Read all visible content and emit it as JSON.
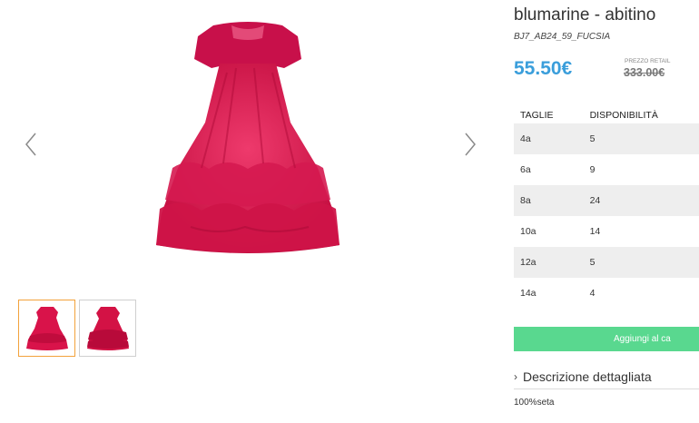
{
  "gallery": {
    "prev_icon": "chevron-left-icon",
    "next_icon": "chevron-right-icon",
    "main_image": "red dress",
    "thumbnails": [
      "dress-front",
      "dress-back"
    ]
  },
  "product": {
    "title": "blumarine - abitino",
    "sku": "BJ7_AB24_59_FUCSIA",
    "price": "55.50€",
    "retail_label": "PREZZO RETAIL",
    "retail_price": "333.00€"
  },
  "sizes_table": {
    "headers": [
      "TAGLIE",
      "DISPONIBILITÀ"
    ],
    "rows": [
      [
        "4a",
        "5"
      ],
      [
        "6a",
        "9"
      ],
      [
        "8a",
        "24"
      ],
      [
        "10a",
        "14"
      ],
      [
        "12a",
        "5"
      ],
      [
        "14a",
        "4"
      ]
    ]
  },
  "actions": {
    "add_to_cart": "Aggiungi al ca"
  },
  "description": {
    "label": "Descrizione dettagliata",
    "material": "100%seta"
  },
  "colors": {
    "price": "#3a9edb",
    "button": "#59d88f",
    "active_thumb": "#f3a23b",
    "dress": "#d9134a"
  }
}
